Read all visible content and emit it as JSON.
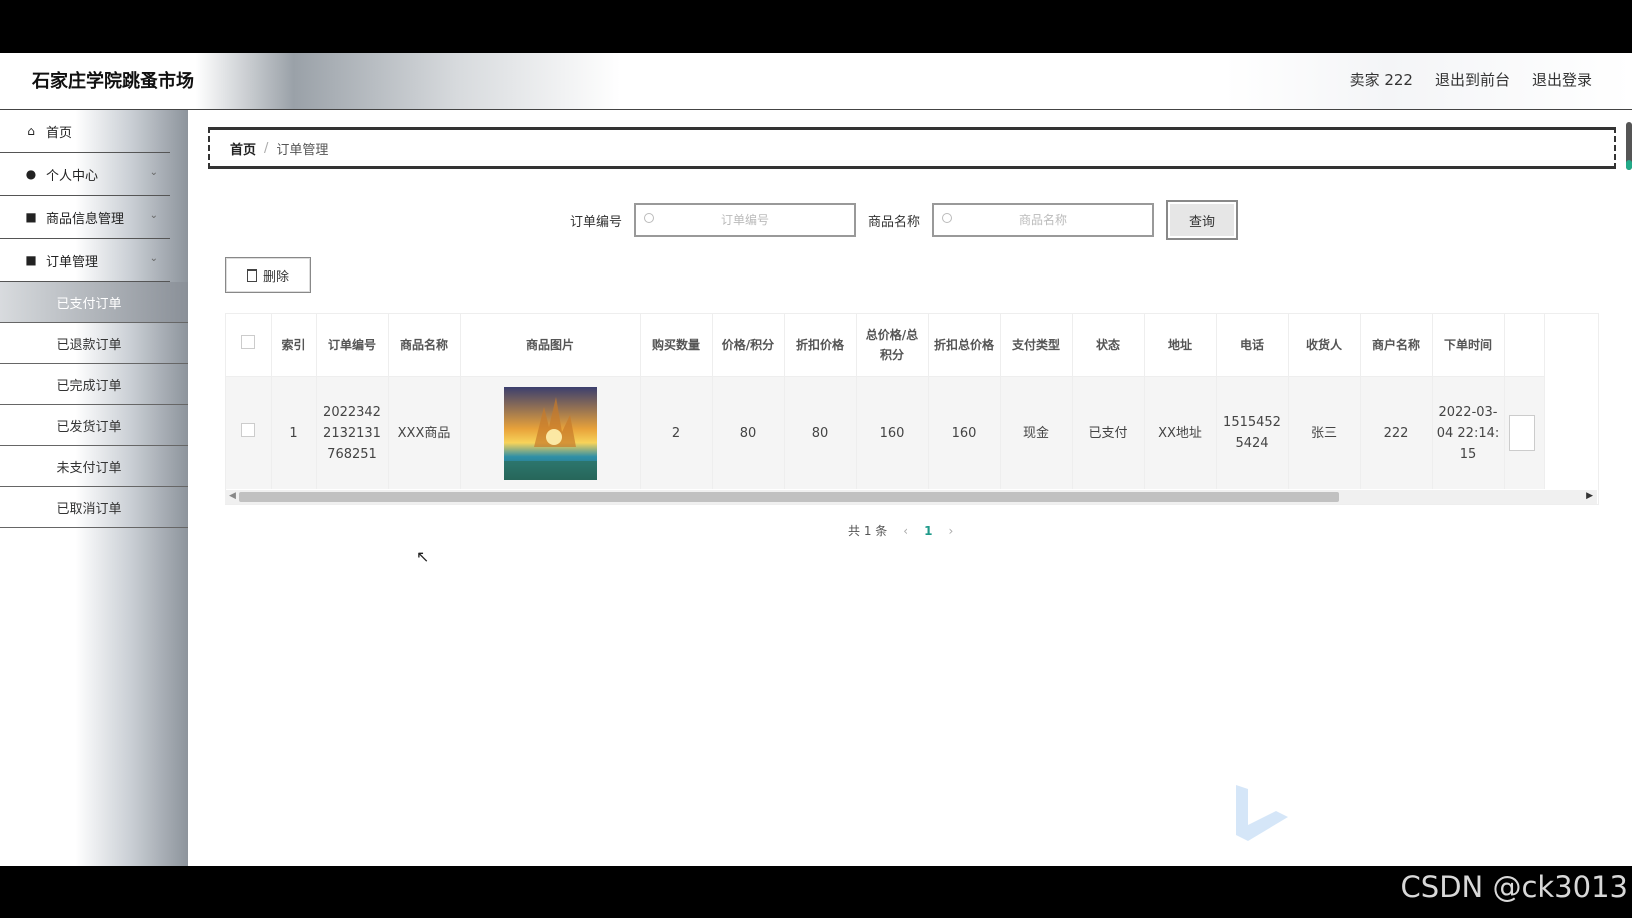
{
  "header": {
    "site_title": "石家庄学院跳蚤市场",
    "user": "卖家 222",
    "exit_front": "退出到前台",
    "logout": "退出登录"
  },
  "sidebar": {
    "items": [
      {
        "label": "首页",
        "icon": "home-icon"
      },
      {
        "label": "个人中心",
        "icon": "user-icon"
      },
      {
        "label": "商品信息管理",
        "icon": "goods-icon"
      },
      {
        "label": "订单管理",
        "icon": "order-icon"
      }
    ],
    "sub_items": [
      "已支付订单",
      "已退款订单",
      "已完成订单",
      "已发货订单",
      "未支付订单",
      "已取消订单"
    ]
  },
  "breadcrumb": {
    "home": "首页",
    "sep": "/",
    "current": "订单管理"
  },
  "search": {
    "order_no_label": "订单编号",
    "order_no_placeholder": "订单编号",
    "goods_name_label": "商品名称",
    "goods_name_placeholder": "商品名称",
    "query_button": "查询"
  },
  "toolbar": {
    "delete_label": "删除"
  },
  "table": {
    "headers": [
      "索引",
      "订单编号",
      "商品名称",
      "商品图片",
      "购买数量",
      "价格/积分",
      "折扣价格",
      "总价格/总积分",
      "折扣总价格",
      "支付类型",
      "状态",
      "地址",
      "电话",
      "收货人",
      "商户名称",
      "下单时间"
    ],
    "rows": [
      {
        "index": "1",
        "order_no": "20223422132131768251",
        "goods_name": "XXX商品",
        "qty": "2",
        "price": "80",
        "discount_price": "80",
        "total": "160",
        "discount_total": "160",
        "pay_type": "现金",
        "status": "已支付",
        "address": "XX地址",
        "phone": "15154525424",
        "receiver": "张三",
        "merchant": "222",
        "order_time": "2022-03-04 22:14:15"
      }
    ]
  },
  "pager": {
    "total": "共 1 条",
    "current": "1",
    "prev": "‹",
    "next": "›"
  },
  "watermark": "CSDN @ck3013",
  "colors": {
    "accent": "#1f9a8a",
    "active_menu": "#8a9098"
  }
}
